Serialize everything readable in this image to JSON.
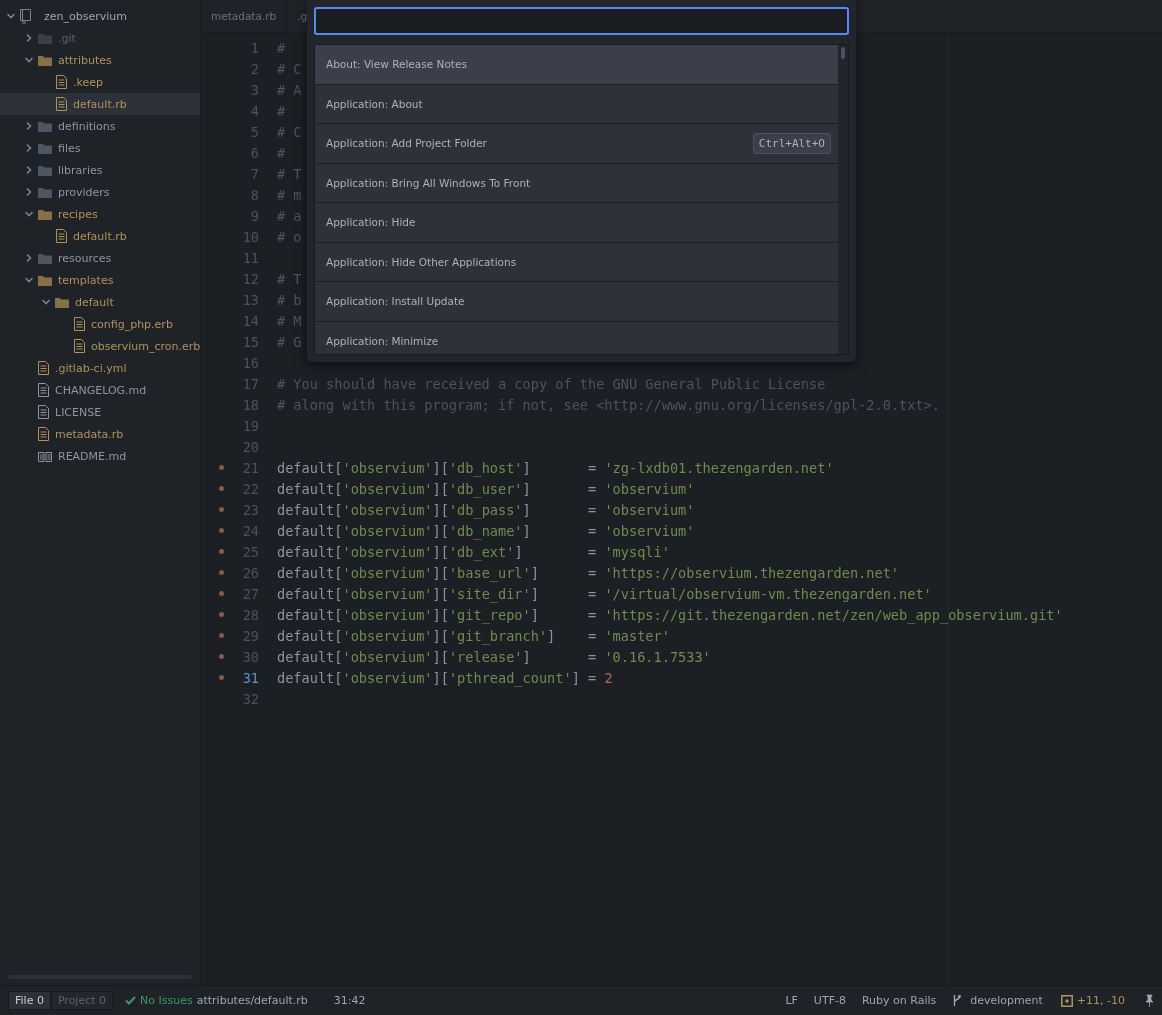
{
  "tree": {
    "label": "zen_observium",
    "expanded": true,
    "children": [
      {
        "label": ".git",
        "kind": "folder",
        "modified": false,
        "ignored": true,
        "expanded": false,
        "selected": false
      },
      {
        "label": "attributes",
        "kind": "folder",
        "modified": true,
        "ignored": false,
        "expanded": true,
        "selected": false,
        "children": [
          {
            "label": ".keep",
            "kind": "file",
            "modified": true,
            "ignored": false,
            "selected": false
          },
          {
            "label": "default.rb",
            "kind": "file",
            "modified": true,
            "ignored": false,
            "selected": true
          }
        ]
      },
      {
        "label": "definitions",
        "kind": "folder",
        "modified": false,
        "ignored": false,
        "expanded": false,
        "selected": false
      },
      {
        "label": "files",
        "kind": "folder",
        "modified": false,
        "ignored": false,
        "expanded": false,
        "selected": false
      },
      {
        "label": "libraries",
        "kind": "folder",
        "modified": false,
        "ignored": false,
        "expanded": false,
        "selected": false
      },
      {
        "label": "providers",
        "kind": "folder",
        "modified": false,
        "ignored": false,
        "expanded": false,
        "selected": false
      },
      {
        "label": "recipes",
        "kind": "folder",
        "modified": true,
        "ignored": false,
        "expanded": true,
        "selected": false,
        "children": [
          {
            "label": "default.rb",
            "kind": "file",
            "modified": true,
            "ignored": false,
            "selected": false
          }
        ]
      },
      {
        "label": "resources",
        "kind": "folder",
        "modified": false,
        "ignored": false,
        "expanded": false,
        "selected": false
      },
      {
        "label": "templates",
        "kind": "folder",
        "modified": true,
        "ignored": false,
        "expanded": true,
        "selected": false,
        "children": [
          {
            "label": "default",
            "kind": "folder",
            "modified": true,
            "ignored": false,
            "expanded": true,
            "selected": false,
            "children": [
              {
                "label": "config_php.erb",
                "kind": "file",
                "modified": true,
                "ignored": false,
                "selected": false
              },
              {
                "label": "observium_cron.erb",
                "kind": "file",
                "modified": true,
                "ignored": false,
                "selected": false
              }
            ]
          }
        ]
      },
      {
        "label": ".gitlab-ci.yml",
        "kind": "file",
        "modified": true,
        "ignored": false,
        "selected": false
      },
      {
        "label": "CHANGELOG.md",
        "kind": "file",
        "modified": false,
        "ignored": false,
        "selected": false
      },
      {
        "label": "LICENSE",
        "kind": "file",
        "modified": false,
        "ignored": false,
        "selected": false
      },
      {
        "label": "metadata.rb",
        "kind": "file",
        "modified": true,
        "ignored": false,
        "selected": false
      },
      {
        "label": "README.md",
        "kind": "readme",
        "modified": false,
        "ignored": false,
        "selected": false
      }
    ]
  },
  "tabs": [
    {
      "label": "metadata.rb",
      "selected": false
    },
    {
      "label": ".g",
      "selected": false
    }
  ],
  "code": [
    {
      "number": "1",
      "kind": "comment",
      "text": "#",
      "modified": false,
      "cursor": false
    },
    {
      "number": "2",
      "kind": "comment",
      "text": "# C",
      "modified": false,
      "cursor": false
    },
    {
      "number": "3",
      "kind": "comment",
      "text": "# A",
      "modified": false,
      "cursor": false
    },
    {
      "number": "4",
      "kind": "comment",
      "text": "#",
      "modified": false,
      "cursor": false
    },
    {
      "number": "5",
      "kind": "comment",
      "text": "# C",
      "modified": false,
      "cursor": false
    },
    {
      "number": "6",
      "kind": "comment",
      "text": "#",
      "modified": false,
      "cursor": false
    },
    {
      "number": "7",
      "kind": "comment",
      "text": "# T",
      "modified": false,
      "cursor": false
    },
    {
      "number": "8",
      "kind": "comment",
      "text": "# m",
      "modified": false,
      "cursor": false
    },
    {
      "number": "9",
      "kind": "comment",
      "text": "# a",
      "modified": false,
      "cursor": false
    },
    {
      "number": "10",
      "kind": "comment",
      "text": "# o",
      "modified": false,
      "cursor": false
    },
    {
      "number": "11",
      "kind": "blank",
      "modified": false,
      "cursor": false
    },
    {
      "number": "12",
      "kind": "comment",
      "text": "# T",
      "modified": false,
      "cursor": false
    },
    {
      "number": "13",
      "kind": "comment",
      "text": "# b",
      "modified": false,
      "cursor": false
    },
    {
      "number": "14",
      "kind": "comment",
      "text": "# M",
      "modified": false,
      "cursor": false
    },
    {
      "number": "15",
      "kind": "comment",
      "text": "# G",
      "modified": false,
      "cursor": false
    },
    {
      "number": "16",
      "kind": "blank",
      "modified": false,
      "cursor": false
    },
    {
      "number": "17",
      "kind": "comment",
      "text": "# You should have received a copy of the GNU General Public License",
      "modified": false,
      "cursor": false
    },
    {
      "number": "18",
      "kind": "comment",
      "text": "# along with this program; if not, see <http://www.gnu.org/licenses/gpl-2.0.txt>.",
      "modified": false,
      "cursor": false
    },
    {
      "number": "19",
      "kind": "blank",
      "modified": false,
      "cursor": false
    },
    {
      "number": "20",
      "kind": "blank",
      "modified": false,
      "cursor": false
    },
    {
      "number": "21",
      "kind": "code",
      "text": "default['observium']['db_host']       = 'zg-lxdb01.thezengarden.net'",
      "modified": true,
      "cursor": false
    },
    {
      "number": "22",
      "kind": "code",
      "text": "default['observium']['db_user']       = 'observium'",
      "modified": true,
      "cursor": false
    },
    {
      "number": "23",
      "kind": "code",
      "text": "default['observium']['db_pass']       = 'observium'",
      "modified": true,
      "cursor": false
    },
    {
      "number": "24",
      "kind": "code",
      "text": "default['observium']['db_name']       = 'observium'",
      "modified": true,
      "cursor": false
    },
    {
      "number": "25",
      "kind": "code",
      "text": "default['observium']['db_ext']        = 'mysqli'",
      "modified": true,
      "cursor": false
    },
    {
      "number": "26",
      "kind": "code",
      "text": "default['observium']['base_url']      = 'https://observium.thezengarden.net'",
      "modified": true,
      "cursor": false
    },
    {
      "number": "27",
      "kind": "code",
      "text": "default['observium']['site_dir']      = '/virtual/observium-vm.thezengarden.net'",
      "modified": true,
      "cursor": false
    },
    {
      "number": "28",
      "kind": "code",
      "text": "default['observium']['git_repo']      = 'https://git.thezengarden.net/zen/web_app_observium.git'",
      "modified": true,
      "cursor": false
    },
    {
      "number": "29",
      "kind": "code",
      "text": "default['observium']['git_branch']    = 'master'",
      "modified": true,
      "cursor": false
    },
    {
      "number": "30",
      "kind": "code",
      "text": "default['observium']['release']       = '0.16.1.7533'",
      "modified": true,
      "cursor": false
    },
    {
      "number": "31",
      "kind": "code",
      "text": "default['observium']['pthread_count'] = 2",
      "modified": true,
      "cursor": true
    },
    {
      "number": "32",
      "kind": "blank",
      "modified": false,
      "cursor": false
    }
  ],
  "palette": {
    "items": [
      {
        "label": "About: View Release Notes",
        "selected": true
      },
      {
        "label": "Application: About",
        "selected": false
      },
      {
        "label": "Application: Add Project Folder",
        "selected": false,
        "shortcut": "Ctrl+Alt+O"
      },
      {
        "label": "Application: Bring All Windows To Front",
        "selected": false
      },
      {
        "label": "Application: Hide",
        "selected": false
      },
      {
        "label": "Application: Hide Other Applications",
        "selected": false
      },
      {
        "label": "Application: Install Update",
        "selected": false
      },
      {
        "label": "Application: Minimize",
        "selected": false
      }
    ]
  },
  "status_bar": {
    "scopes": [
      {
        "label": "File",
        "count": "0",
        "selected": true
      },
      {
        "label": "Project",
        "count": "0",
        "selected": false
      }
    ],
    "issues": "No Issues",
    "path": "attributes/default.rb",
    "position": "31:42",
    "line_ending": "LF",
    "encoding": "UTF-8",
    "grammar": "Ruby on Rails",
    "branch": "development",
    "diff": "+11, -10"
  }
}
